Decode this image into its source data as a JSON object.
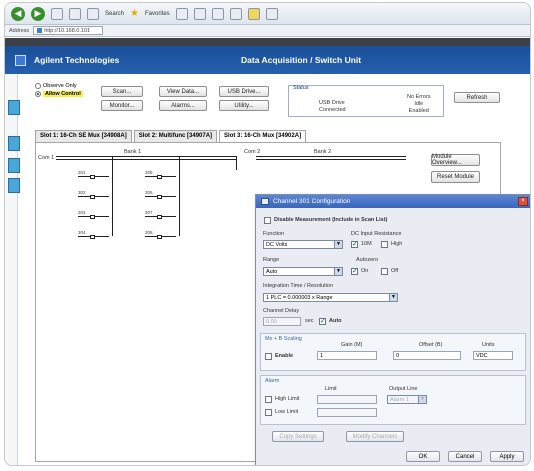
{
  "browser": {
    "address": "http://10.168.0.101",
    "address_label": "Address",
    "search_label": "Search",
    "favorites_label": "Favorites"
  },
  "app": {
    "company": "Agilent Technologies",
    "title": "Data Acquisition / Switch Unit"
  },
  "mode": {
    "option1": "Observe Only",
    "option2": "Allow Control"
  },
  "toolbar": {
    "scan": "Scan...",
    "view_data": "View Data...",
    "usb_drive": "USB Drive...",
    "monitor": "Monitor...",
    "alarms": "Alarms...",
    "utility": "Utility...",
    "refresh": "Refresh"
  },
  "status": {
    "label": "Status",
    "usb_label": "USB Drive",
    "usb_value": "Connected",
    "errors": "No Errors",
    "state1": "Idle",
    "state2": "Enabled"
  },
  "tabs": [
    {
      "label": "Slot 1: 16-Ch SE Mux [34908A]"
    },
    {
      "label": "Slot 2: Multifunc [34907A]"
    },
    {
      "label": "Slot 3: 16-Ch Mux [34902A]"
    }
  ],
  "schematic": {
    "bank1": "Bank 1",
    "bank2": "Bank 2",
    "com1": "Com 1",
    "com2": "Com 2",
    "channels_left": [
      "301",
      "302",
      "303",
      "304"
    ],
    "channels_mid": [
      "305",
      "306",
      "307",
      "308"
    ]
  },
  "side_buttons": {
    "module_overview": "Module Overview...",
    "reset_module": "Reset Module"
  },
  "dialog": {
    "title": "Channel 301 Configuration",
    "disable_measurement": "Disable Measurement (Include in Scan List)",
    "function_label": "Function",
    "function_value": "DC Volts",
    "input_res_label": "DC Input Resistance",
    "res_10m": "10M",
    "res_high": "High",
    "range_label": "Range",
    "range_value": "Auto",
    "autozero_label": "Autozero",
    "autozero_on": "On",
    "autozero_off": "Off",
    "integration_label": "Integration Time / Resolution",
    "integration_value": "1 PLC = 0.000003 x Range",
    "delay_label": "Channel Delay",
    "delay_value": "0.00",
    "delay_unit": "sec",
    "delay_auto": "Auto",
    "scaling_title": "Mx + B Scaling",
    "gain_label": "Gain (M)",
    "offset_label": "Offset (B)",
    "units_label": "Units",
    "scaling_enable": "Enable",
    "gain_value": "1",
    "offset_value": "0",
    "units_value": "VDC",
    "alarm_title": "Alarm",
    "limit_label": "Limit",
    "output_line_label": "Output Line",
    "high_limit": "High Limit",
    "low_limit": "Low Limit",
    "output_line_value": "Alarm 1",
    "copy_btn": "Copy Settings",
    "modify_btn": "Modify Channels",
    "ok": "OK",
    "cancel": "Cancel",
    "apply": "Apply"
  }
}
